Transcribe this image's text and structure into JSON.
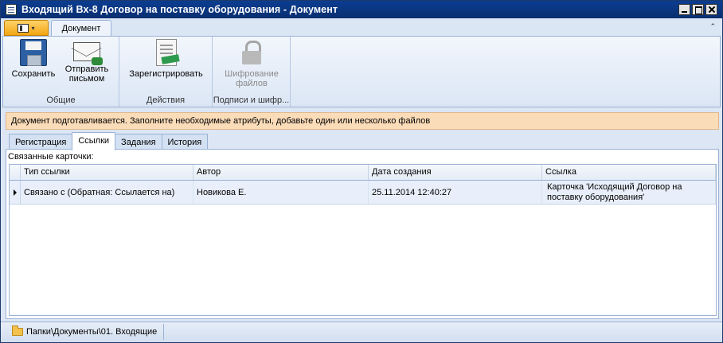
{
  "window": {
    "title": "Входящий Вх-8 Договор на поставку оборудования - Документ"
  },
  "ribbon": {
    "tab_label": "Документ",
    "groups": {
      "general": {
        "label": "Общие",
        "save_label": "Сохранить",
        "send_label_line1": "Отправить",
        "send_label_line2": "письмом"
      },
      "actions": {
        "label": "Действия",
        "register_label": "Зарегистрировать"
      },
      "signatures": {
        "label": "Подписи и шифр...",
        "encrypt_label_line1": "Шифрование",
        "encrypt_label_line2": "файлов"
      }
    }
  },
  "infobar": {
    "text": "Документ подготавливается. Заполните необходимые атрибуты, добавьте один или несколько файлов"
  },
  "tabs": [
    {
      "label": "Регистрация"
    },
    {
      "label": "Ссылки"
    },
    {
      "label": "Задания"
    },
    {
      "label": "История"
    }
  ],
  "links": {
    "section_label": "Связанные карточки:",
    "columns": [
      "Тип ссылки",
      "Автор",
      "Дата создания",
      "Ссылка"
    ],
    "rows": [
      {
        "type": "Связано с (Обратная: Ссылается на)",
        "author": "Новикова Е.",
        "created": "25.11.2014 12:40:27",
        "link_line1": "Карточка 'Исходящий Договор на",
        "link_line2": "поставку оборудования'"
      }
    ]
  },
  "statusbar": {
    "path": "Папки\\Документы\\01. Входящие"
  },
  "colors": {
    "titlebar": "#0b3d91",
    "app_menu": "#f2a512",
    "infobar": "#fbdcb9",
    "ribbon": "#dbe6f5"
  }
}
